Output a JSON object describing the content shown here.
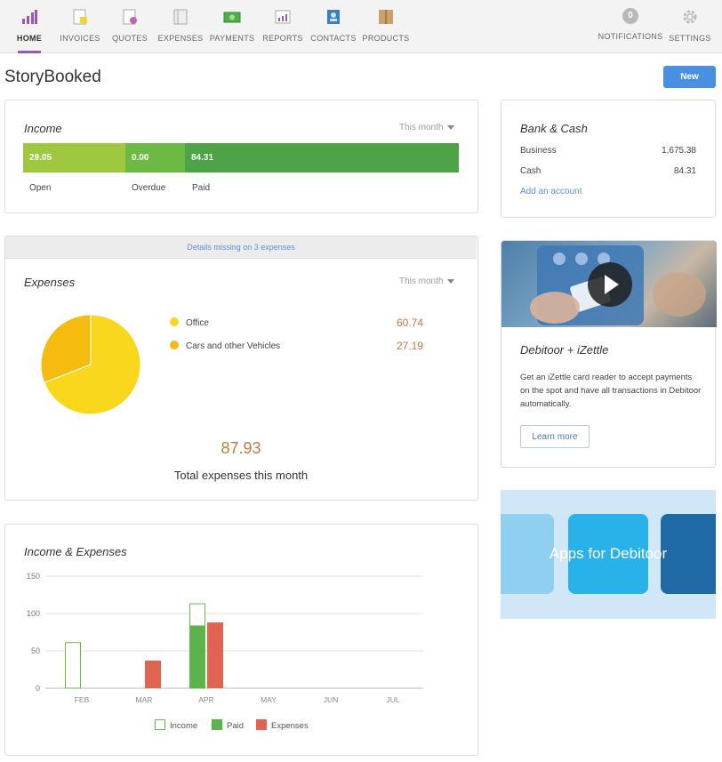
{
  "nav": {
    "left": [
      {
        "label": "HOME",
        "icon": "home-bars-icon",
        "active": true
      },
      {
        "label": "INVOICES",
        "icon": "invoices-icon"
      },
      {
        "label": "QUOTES",
        "icon": "quotes-icon"
      },
      {
        "label": "EXPENSES",
        "icon": "expenses-icon"
      },
      {
        "label": "PAYMENTS",
        "icon": "payments-icon"
      },
      {
        "label": "REPORTS",
        "icon": "reports-icon"
      },
      {
        "label": "CONTACTS",
        "icon": "contacts-icon"
      },
      {
        "label": "PRODUCTS",
        "icon": "products-icon"
      }
    ],
    "notifications": {
      "label": "NOTIFICATIONS",
      "count": "0"
    },
    "settings": {
      "label": "SETTINGS"
    }
  },
  "page": {
    "title": "StoryBooked",
    "new_button": "New"
  },
  "income": {
    "title": "Income",
    "period": "This month",
    "segments": [
      {
        "label": "Open",
        "value": "29.05",
        "color": "#9dc840"
      },
      {
        "label": "Overdue",
        "value": "0.00",
        "color": "#6cb944"
      },
      {
        "label": "Paid",
        "value": "84.31",
        "color": "#4ea346"
      }
    ]
  },
  "bank": {
    "title": "Bank & Cash",
    "accounts": [
      {
        "name": "Business",
        "amount": "1,675.38"
      },
      {
        "name": "Cash",
        "amount": "84.31"
      }
    ],
    "add_link": "Add an account"
  },
  "expenses": {
    "notice": "Details missing on 3 expenses",
    "title": "Expenses",
    "period": "This month",
    "categories": [
      {
        "name": "Office",
        "amount": "60.74",
        "color": "#f9d71c"
      },
      {
        "name": "Cars and other Vehicles",
        "amount": "27.19",
        "color": "#f5bb0f"
      }
    ],
    "total": "87.93",
    "total_label": "Total expenses this month"
  },
  "promo": {
    "title": "Debitoor + iZettle",
    "text": "Get an iZettle card reader to accept payments on the spot and have all transactions in Debitoor automatically.",
    "button": "Learn more"
  },
  "apps_banner": {
    "text": "Apps for Debitoor"
  },
  "chart_data": {
    "type": "bar",
    "title": "Income & Expenses",
    "categories": [
      "FEB",
      "MAR",
      "APR",
      "MAY",
      "JUN",
      "JUL"
    ],
    "ylim": [
      0,
      150
    ],
    "yticks": [
      0,
      50,
      100,
      150
    ],
    "series": [
      {
        "name": "Income",
        "values": [
          61,
          0,
          113,
          0,
          0,
          0
        ],
        "color": "#6cb944",
        "style": "outline"
      },
      {
        "name": "Paid",
        "values": [
          0,
          0,
          84,
          0,
          0,
          0
        ],
        "color": "#5cb34a",
        "style": "filled"
      },
      {
        "name": "Expenses",
        "values": [
          0,
          37,
          88,
          0,
          0,
          0
        ],
        "color": "#e0644f",
        "style": "filled"
      }
    ],
    "legend_position": "bottom-center",
    "grid": true
  }
}
